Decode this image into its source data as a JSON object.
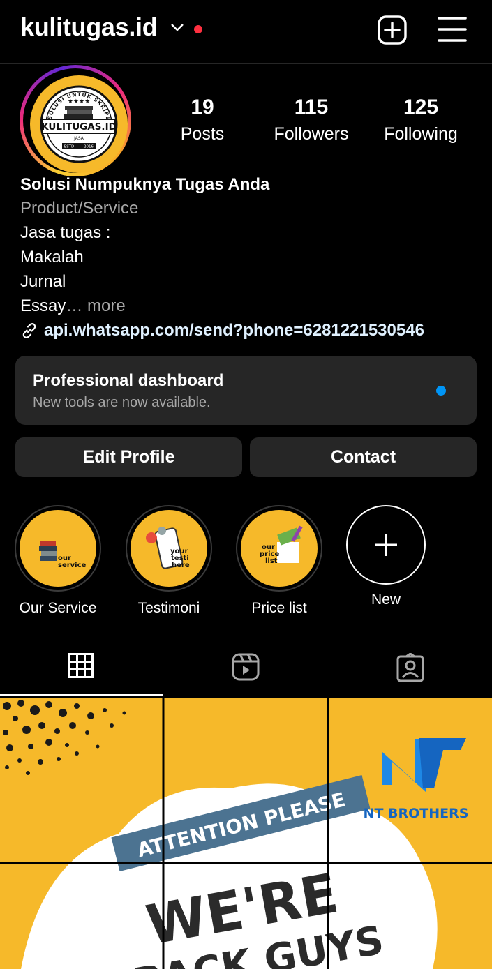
{
  "header": {
    "username": "kulitugas.id",
    "icons": [
      "chevron-down-icon",
      "notification-dot",
      "new-post-icon",
      "menu-icon"
    ]
  },
  "profile": {
    "avatar": {
      "arc_text": "SOLUSI UNTUK SKRIPSI",
      "brand": "KULITUGAS.ID",
      "sub": "JASA",
      "estd": "ESTD",
      "year": "2016"
    },
    "stats": [
      {
        "value": "19",
        "label": "Posts"
      },
      {
        "value": "115",
        "label": "Followers"
      },
      {
        "value": "125",
        "label": "Following"
      }
    ],
    "name": "Solusi Numpuknya Tugas Anda",
    "category": "Product/Service",
    "bio_lines": [
      "Jasa tugas :",
      "Makalah",
      "Jurnal",
      "Essay"
    ],
    "bio_ellipsis": "… ",
    "more_label": "more",
    "link": "api.whatsapp.com/send?phone=6281221530546"
  },
  "dashboard": {
    "title": "Professional dashboard",
    "subtitle": "New tools are now available."
  },
  "actions": {
    "edit_label": "Edit Profile",
    "contact_label": "Contact"
  },
  "highlights": [
    {
      "label": "Our Service",
      "cover_text": [
        "our",
        "service"
      ]
    },
    {
      "label": "Testimoni",
      "cover_text": [
        "your",
        "testi",
        "here"
      ]
    },
    {
      "label": "Price list",
      "cover_text": [
        "our",
        "price",
        "list"
      ]
    },
    {
      "label": "New"
    }
  ],
  "tabs": [
    "grid-icon",
    "reels-icon",
    "tagged-icon"
  ],
  "post": {
    "banner": "ATTENTION PLEASE",
    "headline1": "WE'RE",
    "headline2": "BACK GUYS",
    "logo_text": "NT BROTHERS"
  },
  "colors": {
    "background": "#000000",
    "surface": "#262626",
    "accent_blue": "#0095f6",
    "notification_red": "#ff3040",
    "post_yellow": "#f6b92a",
    "banner_blue": "#4c7391"
  }
}
